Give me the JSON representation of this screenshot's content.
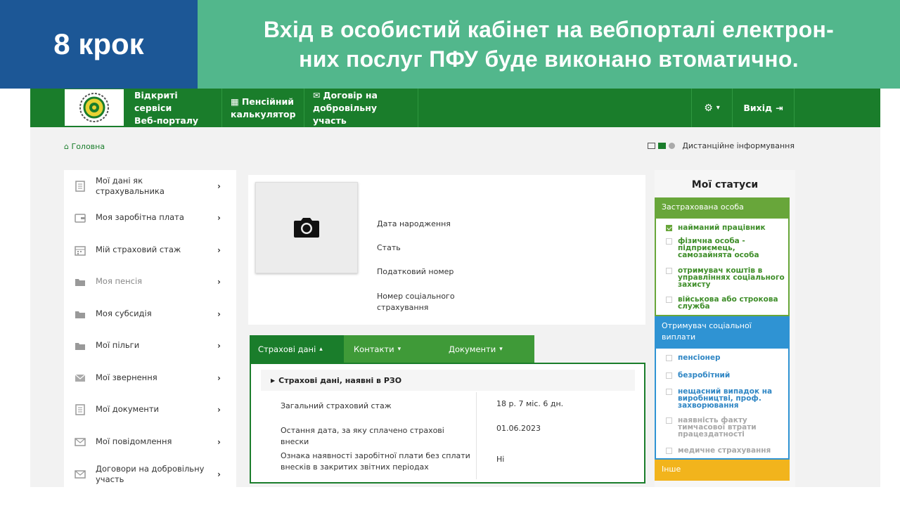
{
  "slide": {
    "step": "8 крок",
    "title_line1": "Вхід в особистий кабінет на вебпорталі електрон-",
    "title_line2": "них послуг  ПФУ буде виконано втоматично."
  },
  "topbar": {
    "brand_line1": "Відкриті сервіси",
    "brand_line2": "Веб-порталу",
    "calc_line1": "Пенсійний",
    "calc_line2": "калькулятор",
    "contract_line1": "Договір на",
    "contract_line2": "добровільну участь",
    "settings_caret": "▾",
    "logout": "Вихід"
  },
  "breadcrumb": {
    "home": "Головна"
  },
  "remote_info": "Дистанційне інформування",
  "sidemenu": {
    "items": [
      {
        "label": "Мої дані як страхувальника",
        "icon": "document-icon"
      },
      {
        "label": "Моя заробітна плата",
        "icon": "wallet-icon"
      },
      {
        "label": "Мій страховий стаж",
        "icon": "calendar-icon"
      },
      {
        "label": "Моя пенсія",
        "icon": "folder-icon"
      },
      {
        "label": "Моя субсидія",
        "icon": "folder-icon"
      },
      {
        "label": "Мої пільги",
        "icon": "folder-icon"
      },
      {
        "label": "Мої звернення",
        "icon": "envelope-icon"
      },
      {
        "label": "Мої документи",
        "icon": "document-icon"
      },
      {
        "label": "Мої повідомлення",
        "icon": "envelope-icon"
      },
      {
        "label": "Договори на добровільну участь",
        "icon": "envelope-icon"
      }
    ]
  },
  "profile": {
    "birth_date": "Дата народження",
    "sex": "Стать",
    "tax_number": "Податковий номер",
    "social_number": "Номер соціального страхування"
  },
  "tabs": {
    "insurance": "Страхові дані",
    "contacts": "Контакти",
    "documents": "Документи"
  },
  "insurance_panel": {
    "heading": "Страхові дані, наявні в РЗО",
    "rows": [
      {
        "label": "Загальний страховий стаж",
        "value": "18 р. 7 міс. 6 дн."
      },
      {
        "label": "Остання дата, за яку сплачено страхові внески",
        "value": "01.06.2023"
      },
      {
        "label": "Ознака наявності заробітної плати без сплати внесків в закритих звітних періодах",
        "value": "Ні"
      }
    ]
  },
  "statuses": {
    "title": "Мої статуси",
    "insured": {
      "heading": "Застрахована особа",
      "items": [
        {
          "label": "найманий працівник",
          "checked": true
        },
        {
          "label": "фізична особа - підприємець, самозайнята особа",
          "checked": false
        },
        {
          "label": "отримувач коштів в управліннях соціального захисту",
          "checked": false
        },
        {
          "label": "військова або строкова служба",
          "checked": false
        }
      ]
    },
    "social": {
      "heading": "Отримувач соціальної виплати",
      "items": [
        {
          "label": "пенсіонер",
          "checked": false
        },
        {
          "label": "безробітний",
          "checked": false
        },
        {
          "label": "нещасний випадок на виробництві, проф. захворювання",
          "checked": false
        },
        {
          "label": "наявність факту тимчасової втрати працездатності",
          "checked": false
        },
        {
          "label": "медичне страхування",
          "checked": false
        }
      ]
    },
    "other": {
      "heading": "Інше"
    }
  },
  "colors": {
    "step_blue": "#1c5796",
    "title_green": "#52b78c",
    "portal_green": "#1a7d2b",
    "status_green": "#68a63a",
    "status_blue": "#2f93d3",
    "status_yellow": "#f2b41c"
  }
}
